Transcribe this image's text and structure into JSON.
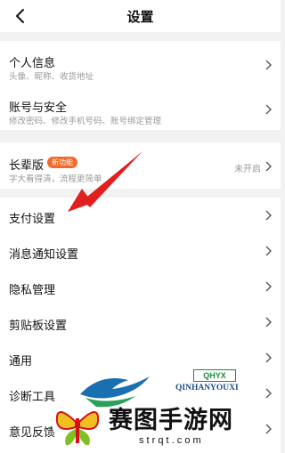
{
  "header": {
    "title": "设置",
    "back_icon": "chevron-left-icon"
  },
  "profile": [
    {
      "label": "个人信息",
      "sub": "头像、昵称、收货地址"
    },
    {
      "label": "账号与安全",
      "sub": "修改密码、修改手机号码、账号绑定管理"
    }
  ],
  "elder": {
    "label": "长辈版",
    "badge": "新功能",
    "sub": "字大看得清，流程更简单",
    "status": "未开启"
  },
  "menu": [
    {
      "label": "支付设置"
    },
    {
      "label": "消息通知设置"
    },
    {
      "label": "隐私管理"
    },
    {
      "label": "剪贴板设置"
    },
    {
      "label": "通用"
    },
    {
      "label": "诊断工具"
    },
    {
      "label": "意见反馈"
    }
  ],
  "watermark": {
    "brand_text": "QINHANYOUXI",
    "brand_short": "QHYX",
    "site_name": "赛图手游网",
    "site_url": "s t r q t . c o m"
  },
  "colors": {
    "badge": "#f06a2b",
    "arrow": "#e02020",
    "background": "#f2f2f2"
  }
}
